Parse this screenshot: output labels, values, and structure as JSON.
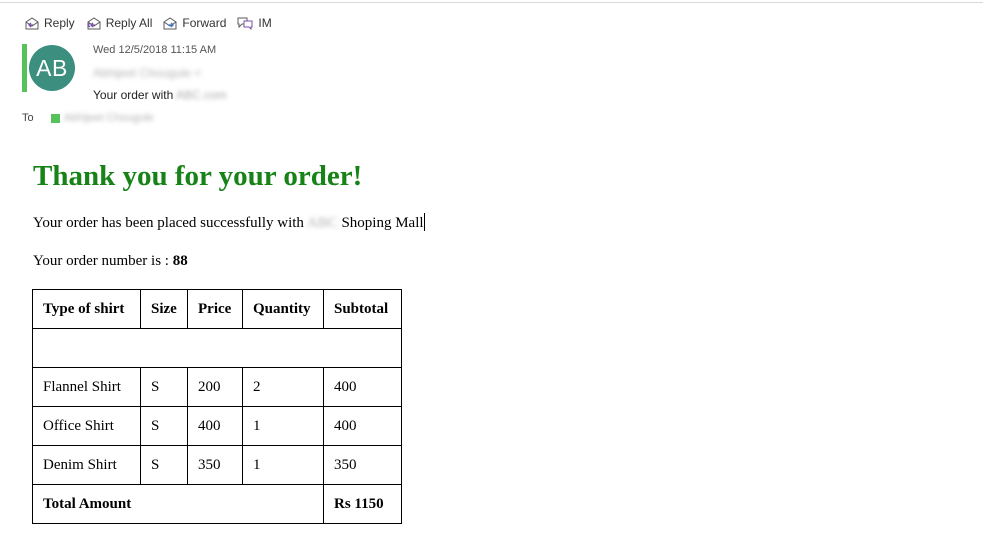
{
  "toolbar": {
    "reply": {
      "label": "Reply",
      "icon": "reply-icon"
    },
    "reply_all": {
      "label": "Reply All",
      "icon": "reply-all-icon"
    },
    "forward": {
      "label": "Forward",
      "icon": "forward-icon"
    },
    "im": {
      "label": "IM",
      "icon": "im-icon"
    }
  },
  "header": {
    "avatar_initials": "AB",
    "avatar_color": "#3c8f7e",
    "accent_color": "#57c15a",
    "date": "Wed 12/5/2018 11:15 AM",
    "from_redacted": "Abhijeet Chougule <",
    "subject_prefix": "Your order with",
    "subject_redacted": "ABC.com",
    "to_label": "To",
    "to_redacted": "Abhijeet Chougule"
  },
  "message": {
    "heading": "Thank you for your order!",
    "heading_color": "#178317",
    "line1_prefix": "Your order has been placed successfully with",
    "line1_redacted": "ABC",
    "line1_suffix": "Shoping Mall",
    "order_number_label": "Your order number is :",
    "order_number": "88"
  },
  "table": {
    "headers": [
      "Type of shirt",
      "Size",
      "Price",
      "Quantity",
      "Subtotal"
    ],
    "rows": [
      [
        "Flannel Shirt",
        "S",
        "200",
        "2",
        "400"
      ],
      [
        "Office Shirt",
        "S",
        "400",
        "1",
        "400"
      ],
      [
        "Denim Shirt",
        "S",
        "350",
        "1",
        "350"
      ]
    ],
    "total_label": "Total Amount",
    "total_value": "Rs 1150"
  }
}
